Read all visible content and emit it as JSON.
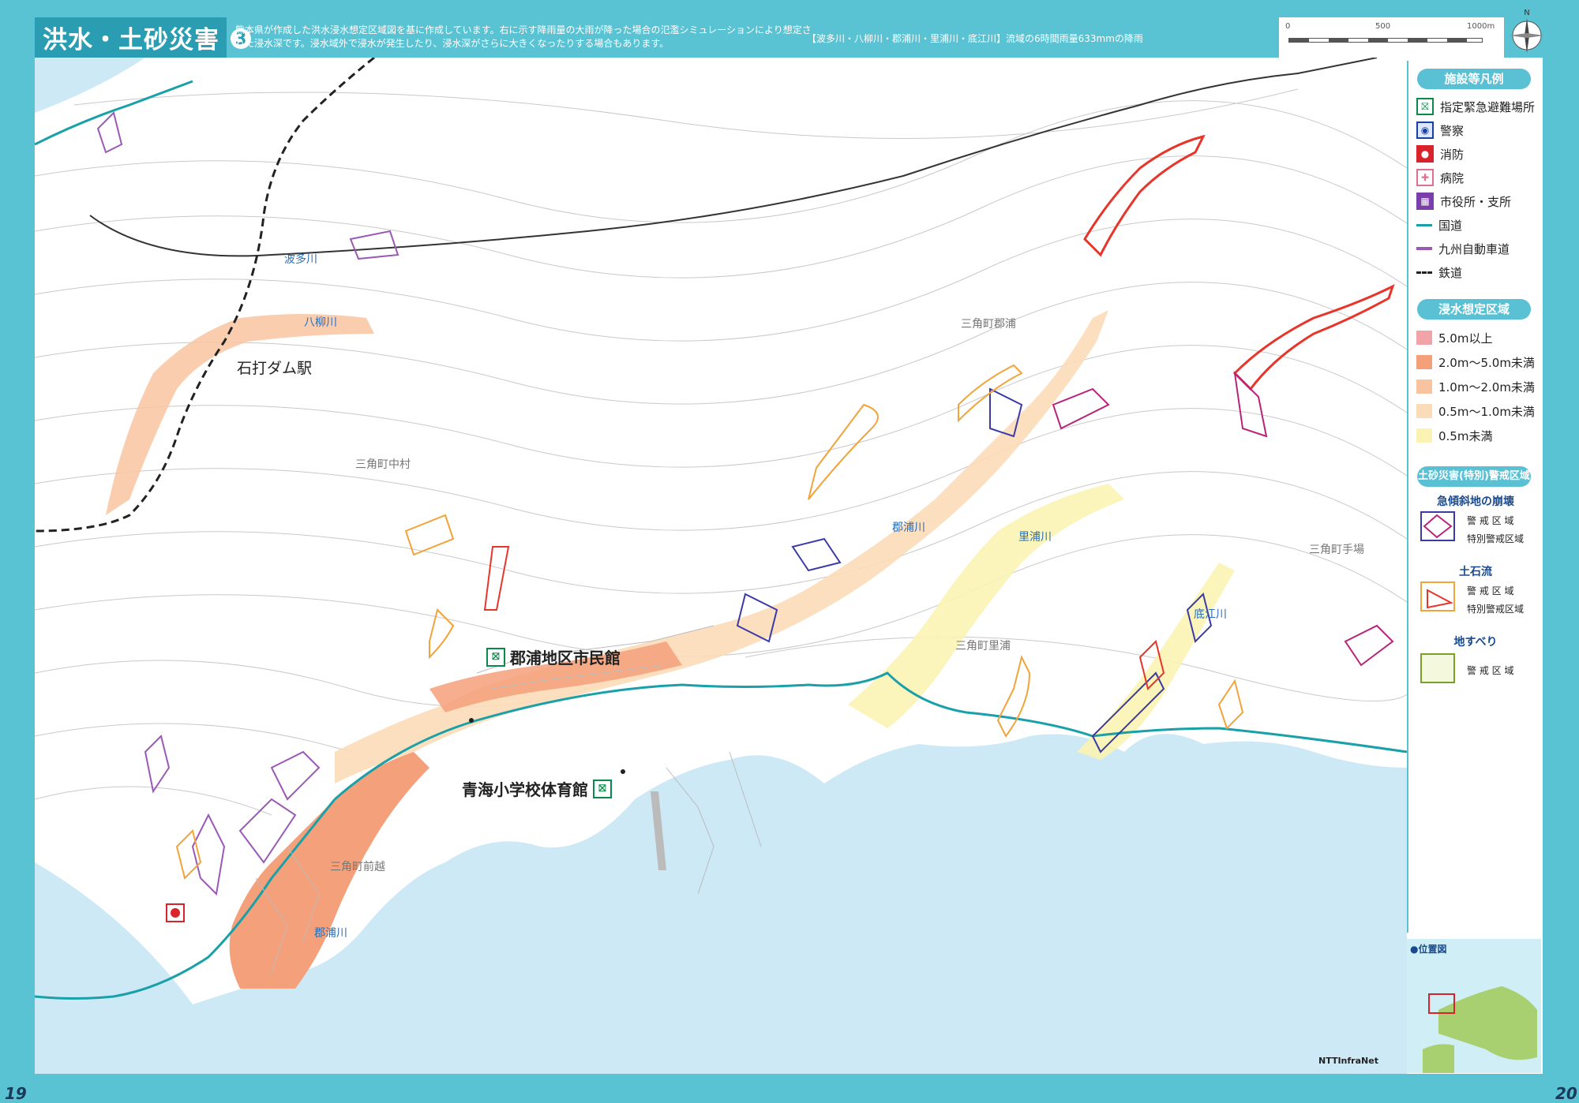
{
  "header": {
    "title": "洪水・土砂災害",
    "number": "3",
    "description": "熊本県が作成した洪水浸水想定区域図を基に作成しています。右に示す降雨量の大雨が降った場合の氾濫シミュレーションにより想定された浸水深です。浸水域外で浸水が発生したり、浸水深がさらに大きくなったりする場合もあります。",
    "rainfall_note": "【波多川・八柳川・郡浦川・里浦川・底江川】流域の6時間雨量633mmの降雨"
  },
  "scale": {
    "labels": [
      "0",
      "500",
      "1000m"
    ]
  },
  "compass": {
    "label": "N"
  },
  "legend": {
    "facilities_title": "施設等凡例",
    "facilities": [
      {
        "icon": "evacuation-icon",
        "label": "指定緊急避難場所",
        "color": "#0a8a4a"
      },
      {
        "icon": "police-icon",
        "label": "警察",
        "color": "#1a3fa0"
      },
      {
        "icon": "fire-icon",
        "label": "消防",
        "color": "#d9232b"
      },
      {
        "icon": "hospital-icon",
        "label": "病院",
        "color": "#e07090"
      },
      {
        "icon": "city-office-icon",
        "label": "市役所・支所",
        "color": "#7a3fa8"
      },
      {
        "icon": "national-road-line",
        "label": "国道",
        "color": "#1aa0a8"
      },
      {
        "icon": "expressway-line",
        "label": "九州自動車道",
        "color": "#9b59b6"
      },
      {
        "icon": "railway-line",
        "label": "鉄道",
        "color": "#222222"
      }
    ],
    "flood_title": "浸水想定区域",
    "flood": [
      {
        "label": "5.0m以上",
        "color": "#f2a3a8"
      },
      {
        "label": "2.0m～5.0m未満",
        "color": "#f4a07a"
      },
      {
        "label": "1.0m～2.0m未満",
        "color": "#f8c4a0"
      },
      {
        "label": "0.5m～1.0m未満",
        "color": "#fbdcb8"
      },
      {
        "label": "0.5m未満",
        "color": "#fbf3b4"
      }
    ],
    "sediment_title": "土砂災害(特別)警戒区域",
    "steep_slope": {
      "title": "急傾斜地の崩壊",
      "warning": "警 戒 区 域",
      "special": "特別警戒区域"
    },
    "debris_flow": {
      "title": "土石流",
      "warning": "警 戒 区 域",
      "special": "特別警戒区域"
    },
    "landslide": {
      "title": "地すべり",
      "warning": "警 戒 区 域"
    },
    "location_title": "●位置図"
  },
  "places": [
    {
      "label": "三角町郡浦"
    },
    {
      "label": "三角町中村"
    },
    {
      "label": "三角町里浦"
    },
    {
      "label": "三角町手場"
    },
    {
      "label": "三角町前越"
    }
  ],
  "rivers": [
    {
      "label": "波多川"
    },
    {
      "label": "八柳川"
    },
    {
      "label": "郡浦川"
    },
    {
      "label": "里浦川"
    },
    {
      "label": "底江川"
    },
    {
      "label": "郡浦川"
    }
  ],
  "station": "石打ダム駅",
  "facilities_on_map": [
    {
      "label": "郡浦地区市民館"
    },
    {
      "label": "青海小学校体育館"
    }
  ],
  "copyright": "NTTInfraNet",
  "pages": {
    "left": "19",
    "right": "20"
  }
}
